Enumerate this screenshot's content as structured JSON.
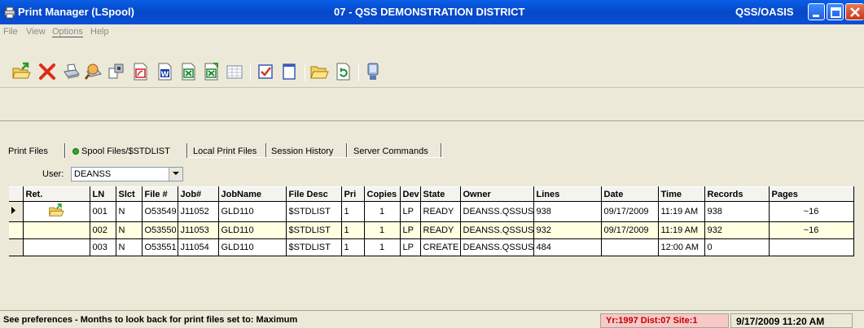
{
  "window": {
    "title": "Print Manager (LSpool)",
    "district": "07 - QSS DEMONSTRATION DISTRICT",
    "system": "QSS/OASIS"
  },
  "menu": {
    "file": "File",
    "view": "View",
    "options": "Options",
    "help": "Help"
  },
  "toolbar": {
    "icons": [
      "open-folder-icon",
      "delete-icon",
      "print-icon",
      "print-preview-icon",
      "properties-icon",
      "pdf-icon",
      "word-icon",
      "excel-icon",
      "excel-export-icon",
      "grid-icon",
      "checkbox-icon",
      "blank-page-icon",
      "folder-open-icon",
      "refresh-icon",
      "exit-icon"
    ]
  },
  "tabs": [
    {
      "label": "Print Files"
    },
    {
      "label": "Spool Files/$STDLIST"
    },
    {
      "label": "Local Print Files"
    },
    {
      "label": "Session History"
    },
    {
      "label": "Server Commands"
    }
  ],
  "filter": {
    "user_label": "User:",
    "user_value": "DEANSS"
  },
  "grid": {
    "columns": [
      "Ret.",
      "LN",
      "Slct",
      "File #",
      "Job#",
      "JobName",
      "File Desc",
      "Pri",
      "Copies",
      "Dev",
      "State",
      "Owner",
      "Lines",
      "Date",
      "Time",
      "Records",
      "Pages"
    ],
    "rows": [
      {
        "ln": "001",
        "slct": "N",
        "file": "O53549",
        "job": "J11052",
        "jobname": "GLD110",
        "desc": "$STDLIST",
        "pri": "1",
        "copies": "1",
        "dev": "LP",
        "state": "READY",
        "owner": "DEANSS.QSSUS",
        "lines": "938",
        "date": "09/17/2009",
        "time": "11:19 AM",
        "records": "938",
        "pages": "~16"
      },
      {
        "ln": "002",
        "slct": "N",
        "file": "O53550",
        "job": "J11053",
        "jobname": "GLD110",
        "desc": "$STDLIST",
        "pri": "1",
        "copies": "1",
        "dev": "LP",
        "state": "READY",
        "owner": "DEANSS.QSSUS",
        "lines": "932",
        "date": "09/17/2009",
        "time": "11:19 AM",
        "records": "932",
        "pages": "~16"
      },
      {
        "ln": "003",
        "slct": "N",
        "file": "O53551",
        "job": "J11054",
        "jobname": "GLD110",
        "desc": "$STDLIST",
        "pri": "1",
        "copies": "1",
        "dev": "LP",
        "state": "CREATE",
        "owner": "DEANSS.QSSUS",
        "lines": "484",
        "date": "",
        "time": "12:00 AM",
        "records": "0",
        "pages": ""
      }
    ]
  },
  "status": {
    "message": "See preferences - Months to look back for print files set to: Maximum",
    "context": "Yr:1997 Dist:07 Site:1",
    "datetime": "9/17/2009 11:20 AM"
  },
  "colors": {
    "titlebar": "#0548c8",
    "selected_row": "#ffffe1",
    "context_bg": "#f7c8c8",
    "context_text": "#c00000"
  }
}
